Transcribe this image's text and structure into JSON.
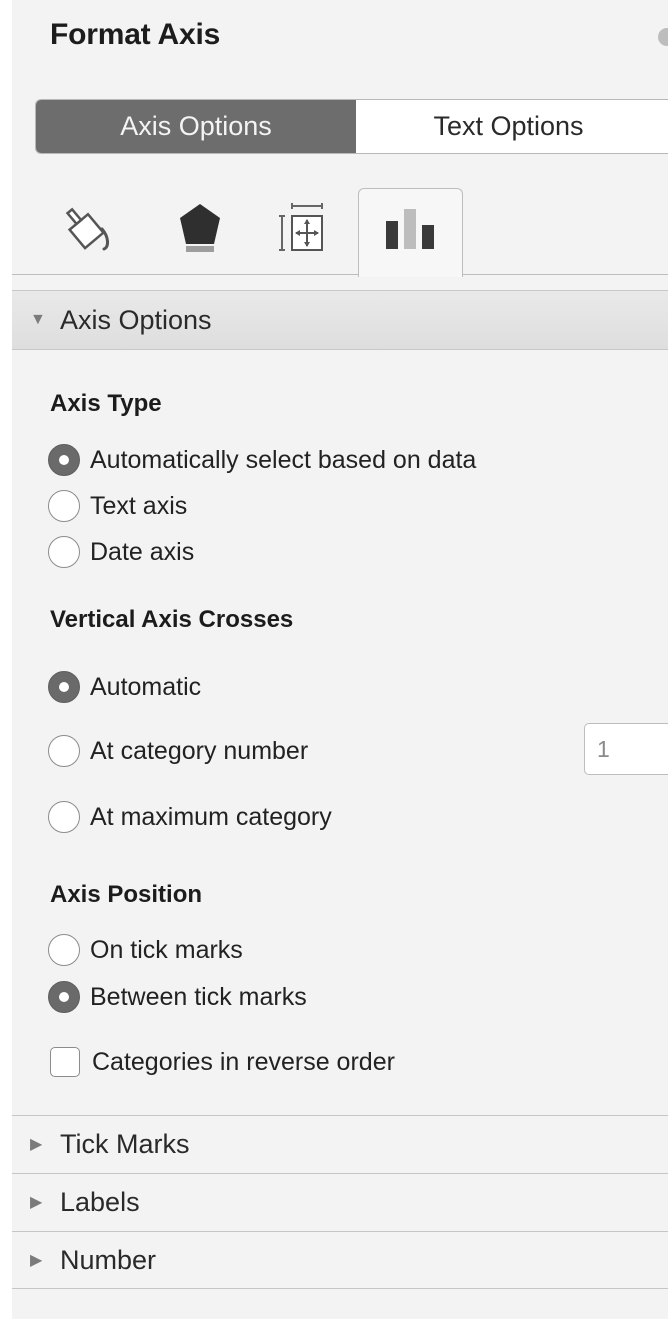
{
  "title": "Format Axis",
  "tabs": {
    "axis_options": "Axis Options",
    "text_options": "Text Options"
  },
  "icon_tabs": [
    {
      "name": "fill-line-icon"
    },
    {
      "name": "effects-icon"
    },
    {
      "name": "size-properties-icon"
    },
    {
      "name": "axis-options-icon",
      "selected": true
    }
  ],
  "sections": {
    "axis_options": "Axis Options",
    "tick_marks": "Tick Marks",
    "labels": "Labels",
    "number": "Number"
  },
  "axis_type": {
    "title": "Axis Type",
    "options": [
      {
        "label": "Automatically select based on data",
        "checked": true
      },
      {
        "label": "Text axis",
        "checked": false
      },
      {
        "label": "Date axis",
        "checked": false
      }
    ]
  },
  "vertical_axis_crosses": {
    "title": "Vertical Axis Crosses",
    "options": [
      {
        "label": "Automatic",
        "checked": true
      },
      {
        "label": "At category number",
        "checked": false
      },
      {
        "label": "At maximum category",
        "checked": false
      }
    ],
    "category_number_value": "1"
  },
  "axis_position": {
    "title": "Axis Position",
    "options": [
      {
        "label": "On tick marks",
        "checked": false
      },
      {
        "label": "Between tick marks",
        "checked": true
      }
    ],
    "reverse_order_label": "Categories in reverse order",
    "reverse_order_checked": false
  },
  "colors": {
    "active_tab": "#6d6d6d",
    "panel_bg": "#f3f3f3"
  }
}
